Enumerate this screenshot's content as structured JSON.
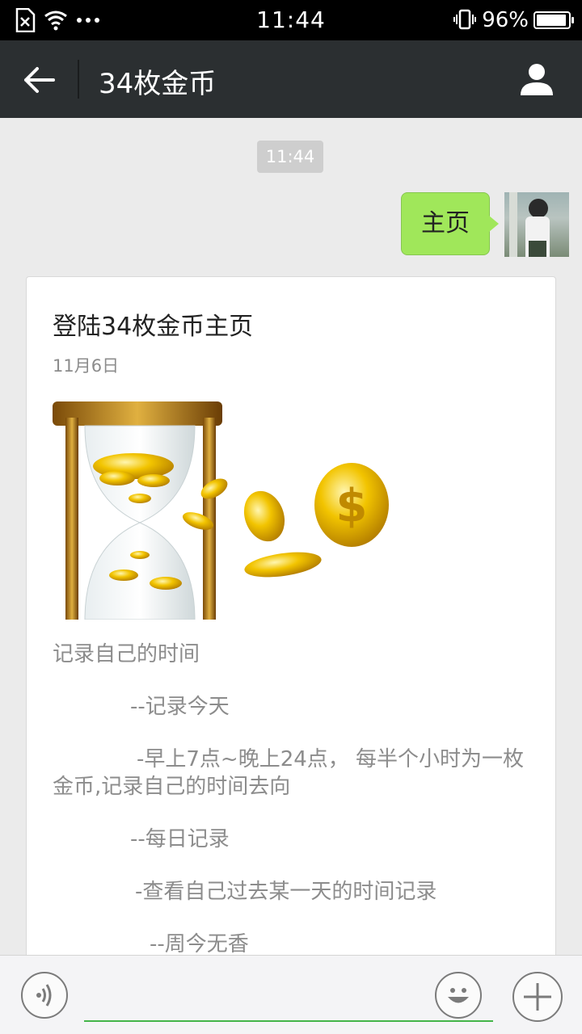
{
  "status_bar": {
    "time": "11:44",
    "battery_percent": "96%",
    "battery_level": 0.96,
    "icons": [
      "sim-missing-icon",
      "wifi-icon",
      "more-dots-icon",
      "vibrate-icon",
      "battery-icon"
    ]
  },
  "header": {
    "title": "34枚金币",
    "back_icon": "arrow-left-icon",
    "profile_icon": "person-icon"
  },
  "chat": {
    "timestamp": "11:44",
    "sent_message": "主页"
  },
  "article": {
    "title": "登陆34枚金币主页",
    "date": "11月6日",
    "image_icon": "hourglass-coins-image",
    "paragraphs": [
      "记录自己的时间",
      "--记录今天",
      "-早上7点~晚上24点，  每半个小时为一枚金币,记录自己的时间去向",
      "--每日记录",
      "-查看自己过去某一天的时间记录",
      "--周今无香"
    ]
  },
  "input_bar": {
    "voice_icon": "voice-icon",
    "emoji_icon": "emoji-icon",
    "add_icon": "plus-icon"
  },
  "colors": {
    "header_bg": "#2b2f31",
    "bubble": "#a0e75a",
    "accent": "#44b549",
    "chat_bg": "#ebebeb"
  }
}
